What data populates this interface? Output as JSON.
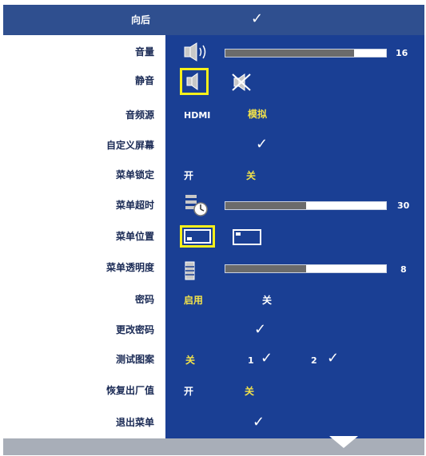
{
  "menu": {
    "back_label": "向后",
    "items": [
      {
        "label": "音量",
        "value": "16",
        "level_percent": 80
      },
      {
        "label": "静音"
      },
      {
        "label": "音频源",
        "options": [
          "HDMI",
          "模拟"
        ],
        "selected": "模拟"
      },
      {
        "label": "自定义屏幕"
      },
      {
        "label": "菜单锁定",
        "options": [
          "开",
          "关"
        ],
        "selected": "关"
      },
      {
        "label": "菜单超时",
        "value": "30",
        "level_percent": 50
      },
      {
        "label": "菜单位置"
      },
      {
        "label": "菜单透明度",
        "value": "8",
        "level_percent": 50
      },
      {
        "label": "密码",
        "options": [
          "启用",
          "关"
        ],
        "selected": "启用"
      },
      {
        "label": "更改密码"
      },
      {
        "label": "测试图案",
        "options": [
          "关",
          "1",
          "2"
        ],
        "selected": "关"
      },
      {
        "label": "恢复出厂值",
        "options": [
          "开",
          "关"
        ],
        "selected": "关"
      },
      {
        "label": "退出菜单"
      }
    ],
    "check_glyph": "✓"
  },
  "colors": {
    "header_bg": "#2f4f8f",
    "right_panel_bg": "#1a3f94",
    "selected_option": "#f2e24a",
    "highlight_border": "#f7f01a",
    "footer_bg": "#a8aeb8"
  },
  "icons": [
    "speaker-icon",
    "muted-speaker-icon",
    "menu-timeout-icon",
    "menu-position-bottom-icon",
    "menu-position-top-icon",
    "transparency-icon",
    "scroll-down-icon"
  ]
}
